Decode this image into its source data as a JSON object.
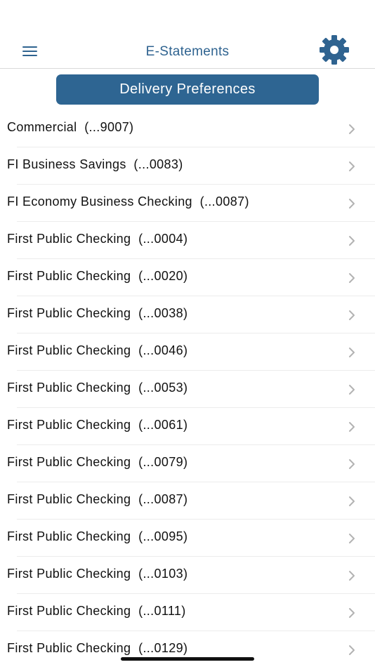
{
  "header": {
    "title": "E-Statements",
    "menu_icon": "hamburger-icon",
    "settings_icon": "gear-icon"
  },
  "delivery_button": {
    "label": "Delivery Preferences"
  },
  "accounts": [
    {
      "label": "Commercial  (...9007)"
    },
    {
      "label": "FI Business Savings  (...0083)"
    },
    {
      "label": "FI Economy Business Checking  (...0087)"
    },
    {
      "label": "First Public Checking  (...0004)"
    },
    {
      "label": "First Public Checking  (...0020)"
    },
    {
      "label": "First Public Checking  (...0038)"
    },
    {
      "label": "First Public Checking  (...0046)"
    },
    {
      "label": "First Public Checking  (...0053)"
    },
    {
      "label": "First Public Checking  (...0061)"
    },
    {
      "label": "First Public Checking  (...0079)"
    },
    {
      "label": "First Public Checking  (...0087)"
    },
    {
      "label": "First Public Checking  (...0095)"
    },
    {
      "label": "First Public Checking  (...0103)"
    },
    {
      "label": "First Public Checking  (...0111)"
    },
    {
      "label": "First Public Checking  (...0129)"
    }
  ],
  "colors": {
    "brand": "#2f6390",
    "button_bg": "#2e6592",
    "chevron": "#b3b3b3",
    "divider": "#ececec"
  }
}
